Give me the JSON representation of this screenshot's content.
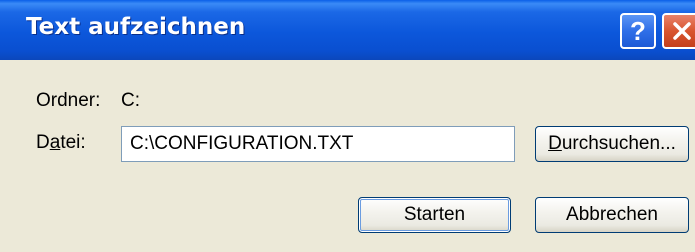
{
  "window": {
    "title": "Text aufzeichnen",
    "help_glyph": "?",
    "close_icon": "close-icon"
  },
  "form": {
    "folder_label": "Ordner:",
    "folder_value": "C:",
    "file_label_pre": "D",
    "file_label_ul": "a",
    "file_label_post": "tei:",
    "file_value": "C:\\CONFIGURATION.TXT"
  },
  "buttons": {
    "browse_ul": "D",
    "browse_rest": "urchsuchen...",
    "start_label": "Starten",
    "cancel_label": "Abbrechen"
  },
  "colors": {
    "titlebar": "#0c57db",
    "dialog_bg": "#ece9d8",
    "close_button": "#d9552f",
    "help_button": "#2f6fe8"
  }
}
